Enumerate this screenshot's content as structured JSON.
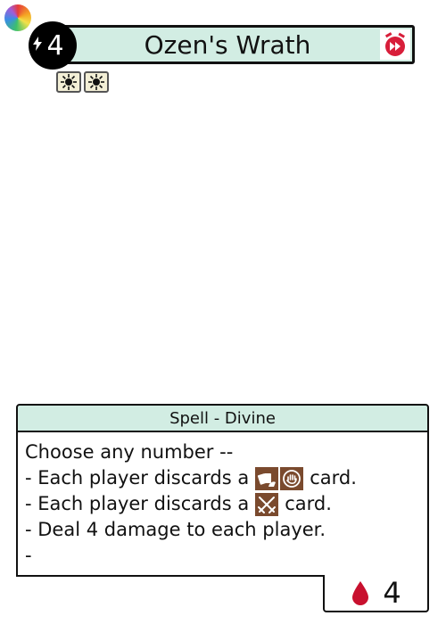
{
  "card": {
    "title": "Ozen's Wrath",
    "cost": "4",
    "type_line": "Spell - Divine",
    "health": "4",
    "tags": [
      "sun-icon",
      "sun-icon"
    ],
    "text": {
      "line1": "Choose any number --",
      "line2_pre": "- Each player discards a",
      "line2_post": "card.",
      "line3_pre": "- Each player discards a",
      "line3_post": "card.",
      "line4": "- Deal 4 damage to each player.",
      "line5": "-"
    }
  },
  "colors": {
    "accent_mint": "#d2ede3",
    "timer_red": "#d81e3a",
    "icon_brown": "#7a4a2e",
    "blood_red": "#c8102e"
  }
}
